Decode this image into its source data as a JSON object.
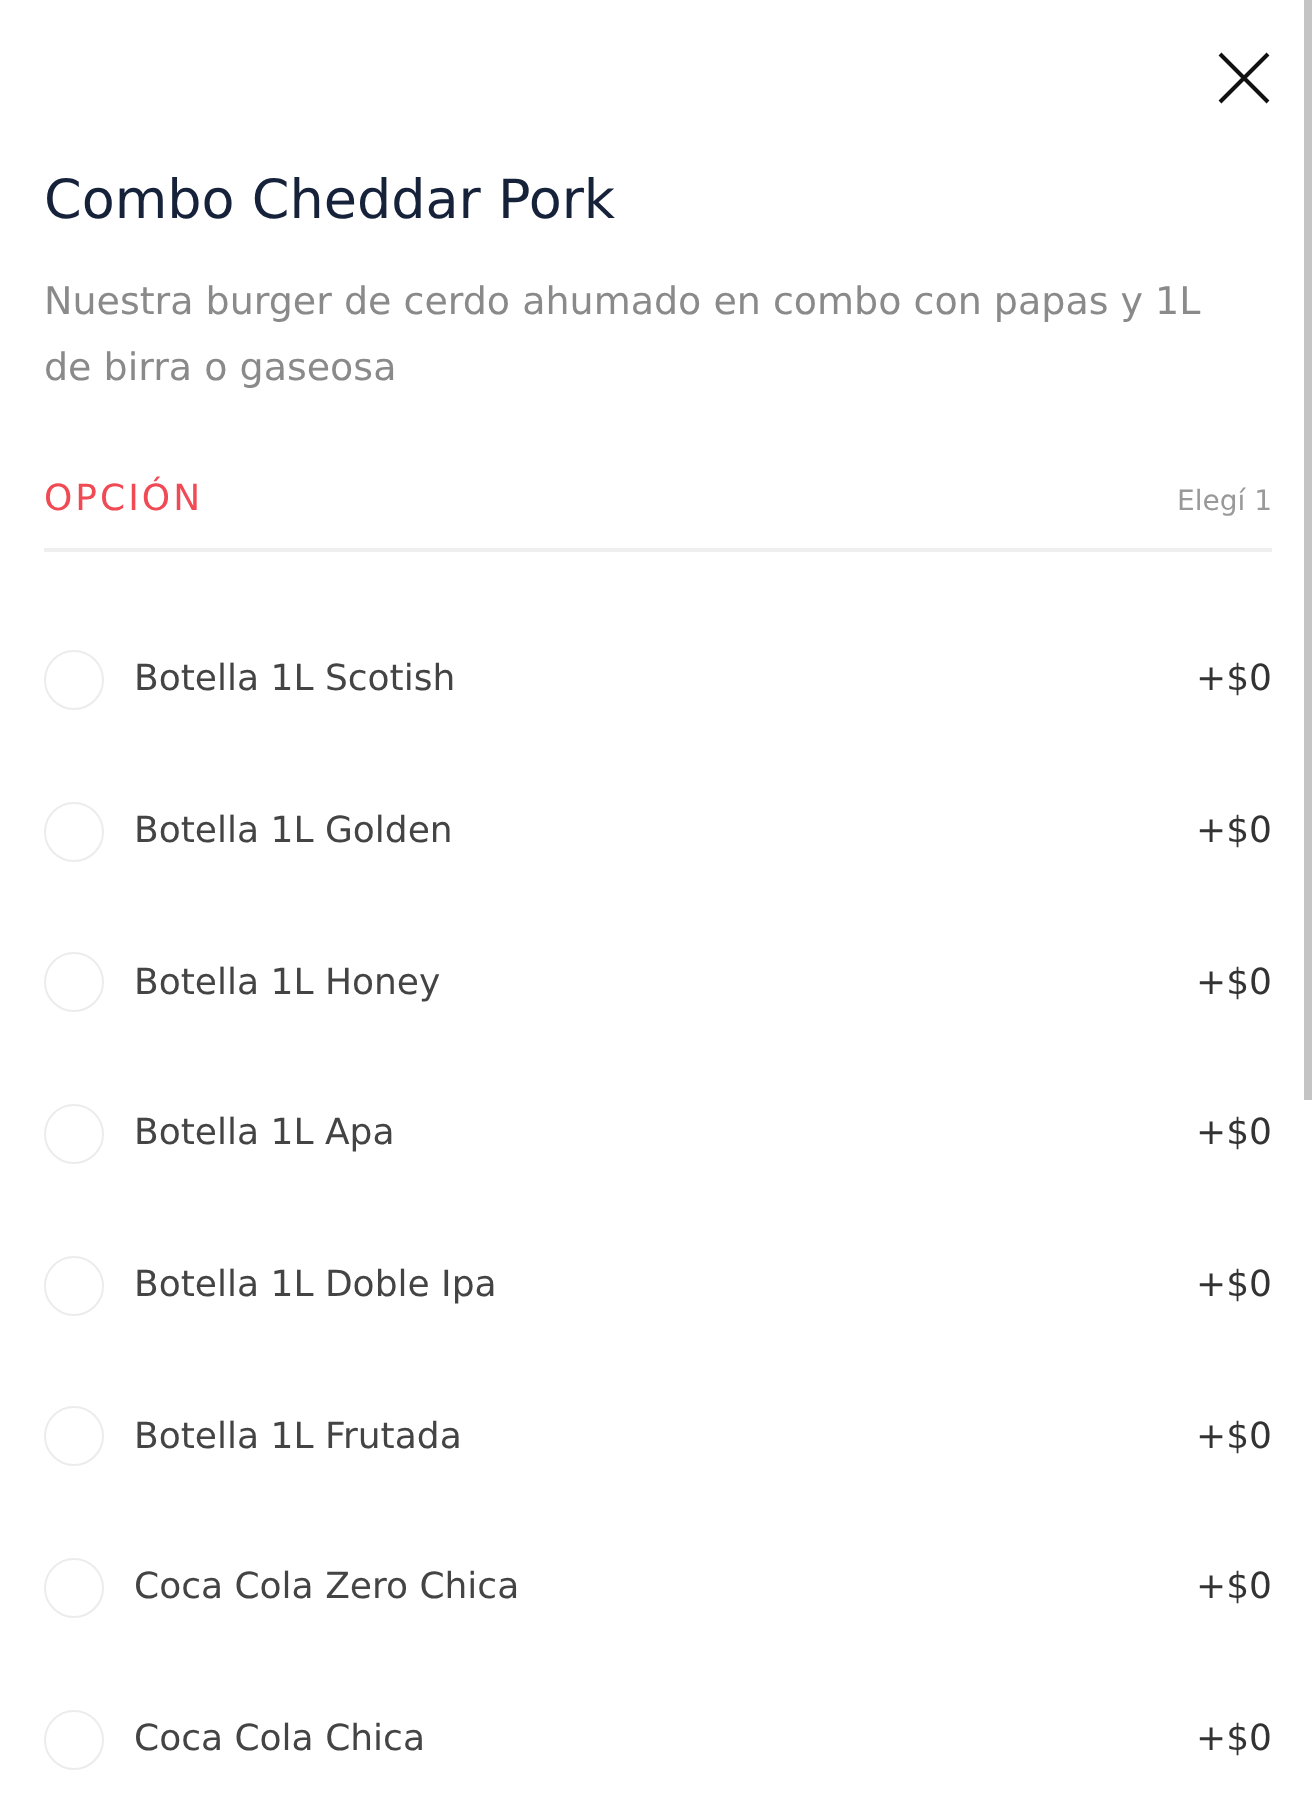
{
  "title": "Combo Cheddar Pork",
  "description": "Nuestra burger de cerdo ahumado en combo con papas y 1L de birra o gaseosa",
  "section": {
    "label": "OPCIÓN",
    "hint": "Elegí 1"
  },
  "options": [
    {
      "name": "Botella 1L Scotish",
      "price": "+$0",
      "selected": false
    },
    {
      "name": "Botella 1L Golden",
      "price": "+$0",
      "selected": false
    },
    {
      "name": "Botella 1L Honey",
      "price": "+$0",
      "selected": false
    },
    {
      "name": "Botella 1L Apa",
      "price": "+$0",
      "selected": false
    },
    {
      "name": "Botella 1L Doble Ipa",
      "price": "+$0",
      "selected": false
    },
    {
      "name": "Botella 1L Frutada",
      "price": "+$0",
      "selected": false
    },
    {
      "name": "Coca Cola Zero Chica",
      "price": "+$0",
      "selected": false
    },
    {
      "name": "Coca Cola Chica",
      "price": "+$0",
      "selected": false
    }
  ]
}
